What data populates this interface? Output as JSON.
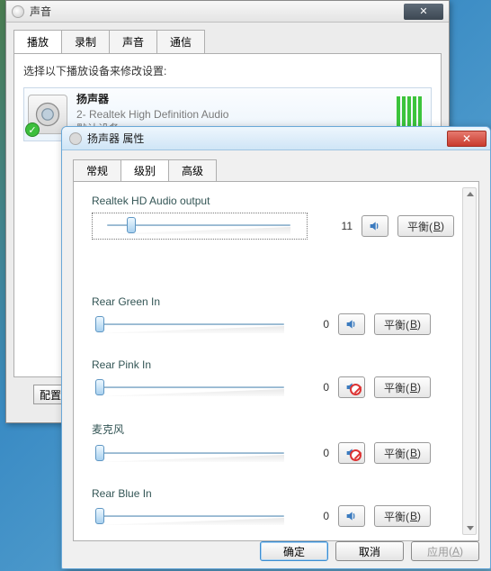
{
  "sound_window": {
    "title": "声音",
    "tabs": [
      "播放",
      "录制",
      "声音",
      "通信"
    ],
    "active_tab": 0,
    "instruction": "选择以下播放设备来修改设置:",
    "device": {
      "name": "扬声器",
      "driver": "2- Realtek High Definition Audio",
      "status": "默认设备"
    },
    "config_button_partial": "配置"
  },
  "props_window": {
    "title": "扬声器 属性",
    "tabs": [
      "常规",
      "级别",
      "高级"
    ],
    "active_tab": 1,
    "channels": [
      {
        "label": "Realtek HD Audio output",
        "value": 11,
        "muted": false,
        "dotted": true
      },
      {
        "label": "Rear Green In",
        "value": 0,
        "muted": false,
        "dotted": false
      },
      {
        "label": "Rear Pink In",
        "value": 0,
        "muted": true,
        "dotted": false
      },
      {
        "label": "麦克风",
        "value": 0,
        "muted": true,
        "dotted": false
      },
      {
        "label": "Rear Blue In",
        "value": 0,
        "muted": false,
        "dotted": false
      }
    ],
    "balance_label": "平衡",
    "balance_hotkey": "B",
    "buttons": {
      "ok": "确定",
      "cancel": "取消",
      "apply": "应用",
      "apply_hotkey": "A"
    }
  }
}
